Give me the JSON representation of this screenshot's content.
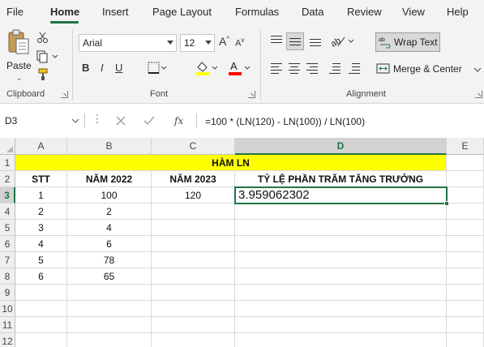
{
  "tabs": [
    "File",
    "Home",
    "Insert",
    "Page Layout",
    "Formulas",
    "Data",
    "Review",
    "View",
    "Help"
  ],
  "ribbon": {
    "clipboard": {
      "paste_label": "Paste",
      "group_label": "Clipboard"
    },
    "font": {
      "font_name": "Arial",
      "font_size": "12",
      "grow_label": "A",
      "shrink_label": "A",
      "group_label": "Font",
      "highlight_color": "#ffff00",
      "font_color": "#ff0000"
    },
    "alignment": {
      "wrap_text_label": "Wrap Text",
      "merge_label": "Merge & Center",
      "group_label": "Alignment"
    }
  },
  "formula_bar": {
    "name_box": "D3",
    "fx_label": "fx",
    "formula": "=100 * (LN(120) - LN(100)) / LN(100)"
  },
  "grid": {
    "columns": [
      "A",
      "B",
      "C",
      "D",
      "E"
    ],
    "rows": [
      "1",
      "2",
      "3",
      "4",
      "5",
      "6",
      "7",
      "8",
      "9",
      "10",
      "11",
      "12"
    ],
    "title": "HÀM LN",
    "headers": [
      "STT",
      "NĂM 2022",
      "NĂM 2023",
      "TỶ LỆ PHẦN TRĂM TĂNG TRƯỞNG"
    ],
    "data_rows": [
      [
        "1",
        "100",
        "120",
        "3.959062302"
      ],
      [
        "2",
        "2",
        "",
        ""
      ],
      [
        "3",
        "4",
        "",
        ""
      ],
      [
        "4",
        "6",
        "",
        ""
      ],
      [
        "5",
        "78",
        "",
        ""
      ],
      [
        "6",
        "65",
        "",
        ""
      ]
    ],
    "accent_color": "#217346",
    "title_fill": "#ffff00"
  }
}
